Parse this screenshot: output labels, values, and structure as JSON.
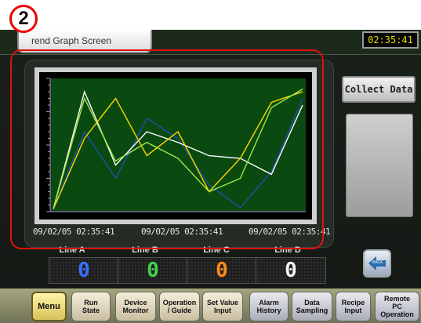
{
  "annotation": {
    "badge_number": "2",
    "colors": {
      "badge_ring": "#e00000",
      "frame": "#e01010"
    }
  },
  "header": {
    "title_tab": "rend Graph Screen",
    "clock": "02:35:41"
  },
  "graph": {
    "plot_background": "#0a4a10",
    "timestamps": [
      "09/02/05 02:35:41",
      "09/02/05 02:35:41",
      "09/02/05 02:35:41"
    ]
  },
  "chart_data": {
    "type": "line",
    "x": [
      0,
      1,
      2,
      3,
      4,
      5,
      6,
      7,
      8
    ],
    "ylim": [
      0,
      100
    ],
    "series": [
      {
        "values": [
          2,
          60,
          25,
          70,
          55,
          20,
          3,
          30,
          85
        ],
        "color": "#1f4fb0"
      },
      {
        "values": [
          2,
          90,
          35,
          60,
          52,
          42,
          40,
          28,
          80
        ],
        "color": "#ffffff"
      },
      {
        "values": [
          2,
          55,
          85,
          42,
          60,
          15,
          40,
          82,
          90
        ],
        "color": "#ffd700"
      },
      {
        "values": [
          2,
          85,
          38,
          52,
          40,
          15,
          25,
          78,
          92
        ],
        "color": "#9ee54a"
      }
    ]
  },
  "lines": [
    {
      "label": "Line A",
      "value": "0",
      "color": "#3a6fff"
    },
    {
      "label": "Line B",
      "value": "0",
      "color": "#41d24b"
    },
    {
      "label": "Line C",
      "value": "0",
      "color": "#ff8a1a"
    },
    {
      "label": "Line D",
      "value": "0",
      "color": "#f2f2f2"
    }
  ],
  "side": {
    "collect_data_label": "Collect Data",
    "back_label": "BACK"
  },
  "nav": [
    {
      "label": "Menu",
      "style": "menu"
    },
    {
      "label": "Run\nState",
      "style": "tan"
    },
    {
      "label": "Device\nMonitor",
      "style": "tan"
    },
    {
      "label": "Operation\n/ Guide",
      "style": "tan"
    },
    {
      "label": "Set Value\nInput",
      "style": "tan"
    },
    {
      "label": "Alarm\nHistory",
      "style": "gray"
    },
    {
      "label": "Data\nSampling",
      "style": "gray"
    },
    {
      "label": "Recipe\nInput",
      "style": "gray"
    },
    {
      "label": "Remote\nPC\nOperation",
      "style": "gray"
    }
  ]
}
